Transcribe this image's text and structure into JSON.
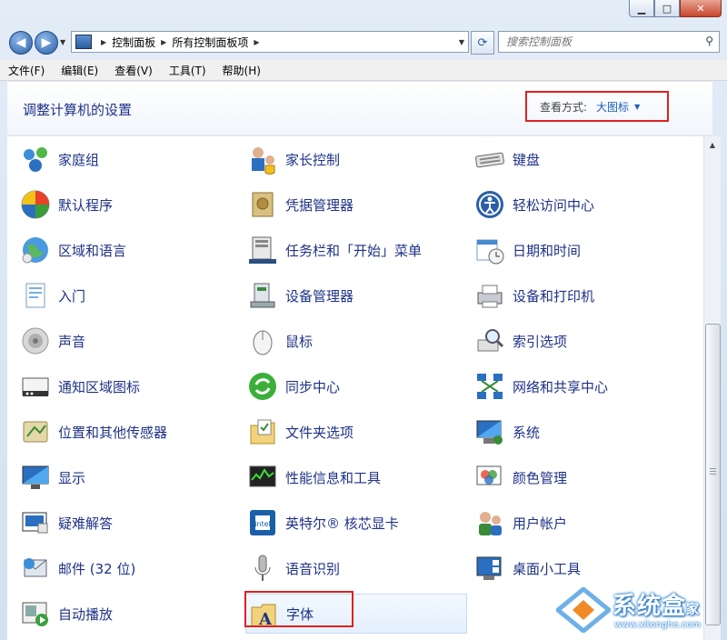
{
  "window": {
    "minimize_glyph": "▁",
    "maximize_glyph": "□",
    "close_glyph": "✕"
  },
  "nav": {
    "back_glyph": "◀",
    "forward_glyph": "▶",
    "history_drop_glyph": "▼",
    "address_crumbs": [
      "控制面板",
      "所有控制面板项"
    ],
    "crumb_sep_glyph": "▶",
    "address_drop_glyph": "▼",
    "refresh_glyph": "⟳",
    "search_placeholder": "搜索控制面板",
    "search_icon_glyph": "⚲"
  },
  "menu": [
    "文件(F)",
    "编辑(E)",
    "查看(V)",
    "工具(T)",
    "帮助(H)"
  ],
  "header": {
    "title": "调整计算机的设置",
    "view_label": "查看方式:",
    "view_value": "大图标",
    "view_arrow": "▼"
  },
  "columns": [
    [
      {
        "label": "家庭组",
        "icon": "homegroup-icon"
      },
      {
        "label": "默认程序",
        "icon": "default-programs-icon"
      },
      {
        "label": "区域和语言",
        "icon": "region-language-icon"
      },
      {
        "label": "入门",
        "icon": "getting-started-icon"
      },
      {
        "label": "声音",
        "icon": "sound-icon"
      },
      {
        "label": "通知区域图标",
        "icon": "notification-area-icon"
      },
      {
        "label": "位置和其他传感器",
        "icon": "location-sensors-icon"
      },
      {
        "label": "显示",
        "icon": "display-icon"
      },
      {
        "label": "疑难解答",
        "icon": "troubleshooting-icon"
      },
      {
        "label": "邮件 (32 位)",
        "icon": "mail-icon"
      },
      {
        "label": "自动播放",
        "icon": "autoplay-icon"
      }
    ],
    [
      {
        "label": "家长控制",
        "icon": "parental-controls-icon"
      },
      {
        "label": "凭据管理器",
        "icon": "credential-manager-icon"
      },
      {
        "label": "任务栏和「开始」菜单",
        "icon": "taskbar-start-menu-icon"
      },
      {
        "label": "设备管理器",
        "icon": "device-manager-icon"
      },
      {
        "label": "鼠标",
        "icon": "mouse-icon"
      },
      {
        "label": "同步中心",
        "icon": "sync-center-icon"
      },
      {
        "label": "文件夹选项",
        "icon": "folder-options-icon"
      },
      {
        "label": "性能信息和工具",
        "icon": "performance-icon"
      },
      {
        "label": "英特尔® 核芯显卡",
        "icon": "intel-graphics-icon"
      },
      {
        "label": "语音识别",
        "icon": "speech-recognition-icon"
      },
      {
        "label": "字体",
        "icon": "fonts-icon"
      }
    ],
    [
      {
        "label": "键盘",
        "icon": "keyboard-icon"
      },
      {
        "label": "轻松访问中心",
        "icon": "ease-of-access-icon"
      },
      {
        "label": "日期和时间",
        "icon": "date-time-icon"
      },
      {
        "label": "设备和打印机",
        "icon": "devices-printers-icon"
      },
      {
        "label": "索引选项",
        "icon": "indexing-options-icon"
      },
      {
        "label": "网络和共享中心",
        "icon": "network-sharing-icon"
      },
      {
        "label": "系统",
        "icon": "system-icon"
      },
      {
        "label": "颜色管理",
        "icon": "color-management-icon"
      },
      {
        "label": "用户帐户",
        "icon": "user-accounts-icon"
      },
      {
        "label": "桌面小工具",
        "icon": "desktop-gadgets-icon"
      }
    ]
  ],
  "colors": {
    "link": "#1e3287",
    "highlight_box": "#e02020",
    "view_value": "#1c5fb8"
  },
  "watermark": {
    "text": "系统盒",
    "suffix": "家",
    "url": "www.xitonghe.com"
  }
}
